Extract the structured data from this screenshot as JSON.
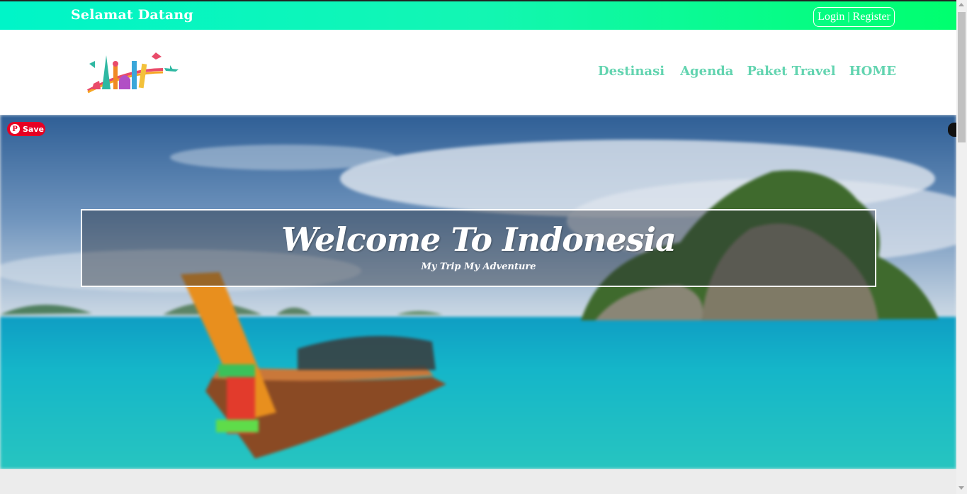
{
  "topbar": {
    "welcome": "Selamat Datang",
    "login": "Login",
    "separator": "|",
    "register": "Register"
  },
  "nav": {
    "items": [
      "Destinasi",
      "Agenda",
      "Paket Travel",
      "HOME"
    ]
  },
  "hero": {
    "title": "Welcome To Indonesia",
    "subtitle": "My Trip My Adventure",
    "save_label": "Save"
  },
  "colors": {
    "topbar_start": "#00f5c8",
    "topbar_end": "#00ff6e",
    "nav_text": "#63d4b0",
    "pinterest": "#e60023"
  },
  "icons": {
    "logo": "travel-landmarks-logo",
    "pinterest": "pinterest-icon",
    "edge": "extension-icon"
  }
}
